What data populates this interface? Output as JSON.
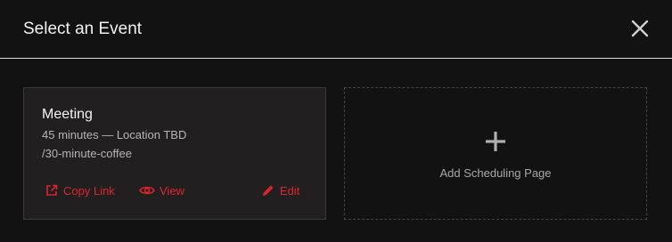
{
  "header": {
    "title": "Select an Event"
  },
  "event_card": {
    "title": "Meeting",
    "meta": "45 minutes — Location TBD",
    "slug": "/30-minute-coffee",
    "actions": {
      "copy_link": "Copy Link",
      "view": "View",
      "edit": "Edit"
    }
  },
  "add_card": {
    "label": "Add Scheduling Page"
  },
  "colors": {
    "background": "#121212",
    "card_background": "#211f1f",
    "accent": "#e0242b",
    "text_primary": "#f5f5f5",
    "text_secondary": "#b5b5b5"
  },
  "icons": {
    "close": "close-icon",
    "copy_link": "external-link-icon",
    "view": "eye-icon",
    "edit": "pencil-icon",
    "add": "plus-icon"
  }
}
